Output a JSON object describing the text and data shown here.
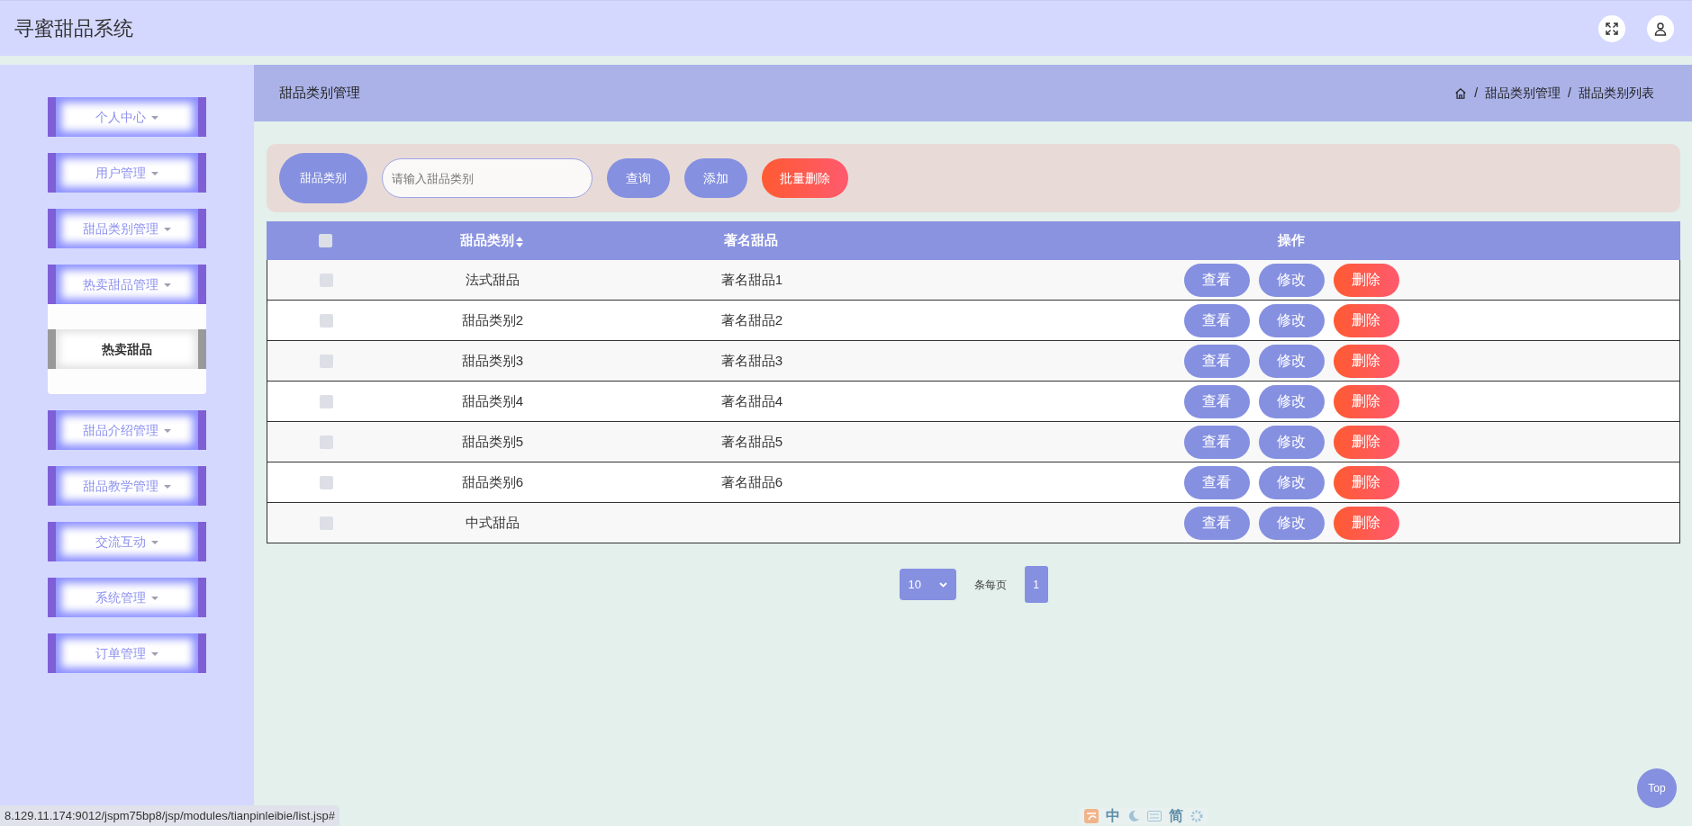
{
  "header": {
    "title": "寻蜜甜品系统"
  },
  "sidebar": {
    "menus": [
      {
        "label": "个人中心",
        "expanded": false
      },
      {
        "label": "用户管理",
        "expanded": false
      },
      {
        "label": "甜品类别管理",
        "expanded": false
      },
      {
        "label": "热卖甜品管理",
        "expanded": true,
        "children": [
          {
            "label": "热卖甜品"
          }
        ]
      },
      {
        "label": "甜品介绍管理",
        "expanded": false
      },
      {
        "label": "甜品教学管理",
        "expanded": false
      },
      {
        "label": "交流互动",
        "expanded": false
      },
      {
        "label": "系统管理",
        "expanded": false
      },
      {
        "label": "订单管理",
        "expanded": false
      }
    ]
  },
  "page_header": {
    "title": "甜品类别管理",
    "breadcrumb": [
      {
        "separator": "/",
        "label": "甜品类别管理"
      },
      {
        "separator": "/",
        "label": "甜品类别列表"
      }
    ]
  },
  "search": {
    "label": "甜品类别",
    "placeholder": "请输入甜品类别",
    "buttons": [
      {
        "label": "查询",
        "kind": "primary"
      },
      {
        "label": "添加",
        "kind": "primary"
      },
      {
        "label": "批量删除",
        "kind": "danger"
      }
    ]
  },
  "table": {
    "select_all": {
      "checked": false
    },
    "columns": [
      {
        "label": "甜品类别",
        "sortable": true
      },
      {
        "label": "著名甜品",
        "sortable": false
      },
      {
        "label": "操作",
        "sortable": false
      }
    ],
    "rows": [
      {
        "selected": false,
        "type": "法式甜品",
        "name": "著名甜品1",
        "actions": [
          {
            "label": "查看",
            "kind": "primary"
          },
          {
            "label": "修改",
            "kind": "primary"
          },
          {
            "label": "删除",
            "kind": "danger"
          }
        ]
      },
      {
        "selected": false,
        "type": "甜品类别2",
        "name": "著名甜品2",
        "actions": [
          {
            "label": "查看",
            "kind": "primary"
          },
          {
            "label": "修改",
            "kind": "primary"
          },
          {
            "label": "删除",
            "kind": "danger"
          }
        ]
      },
      {
        "selected": false,
        "type": "甜品类别3",
        "name": "著名甜品3",
        "actions": [
          {
            "label": "查看",
            "kind": "primary"
          },
          {
            "label": "修改",
            "kind": "primary"
          },
          {
            "label": "删除",
            "kind": "danger"
          }
        ]
      },
      {
        "selected": false,
        "type": "甜品类别4",
        "name": "著名甜品4",
        "actions": [
          {
            "label": "查看",
            "kind": "primary"
          },
          {
            "label": "修改",
            "kind": "primary"
          },
          {
            "label": "删除",
            "kind": "danger"
          }
        ]
      },
      {
        "selected": false,
        "type": "甜品类别5",
        "name": "著名甜品5",
        "actions": [
          {
            "label": "查看",
            "kind": "primary"
          },
          {
            "label": "修改",
            "kind": "primary"
          },
          {
            "label": "删除",
            "kind": "danger"
          }
        ]
      },
      {
        "selected": false,
        "type": "甜品类别6",
        "name": "著名甜品6",
        "actions": [
          {
            "label": "查看",
            "kind": "primary"
          },
          {
            "label": "修改",
            "kind": "primary"
          },
          {
            "label": "删除",
            "kind": "danger"
          }
        ]
      },
      {
        "selected": false,
        "type": "中式甜品",
        "actions": [
          {
            "label": "查看",
            "kind": "primary"
          },
          {
            "label": "修改",
            "kind": "primary"
          },
          {
            "label": "删除",
            "kind": "danger"
          }
        ]
      }
    ]
  },
  "pagination": {
    "page_size": "10",
    "page_size_label": "条每页",
    "pages": [
      {
        "label": "1",
        "selected": true
      }
    ]
  },
  "back_to_top": "Top",
  "ime_bar": {
    "mode": "中",
    "script": "简"
  },
  "status_url": "8.129.11.174:9012/jspm75bp8/jsp/modules/tianpinleibie/list.jsp#"
}
